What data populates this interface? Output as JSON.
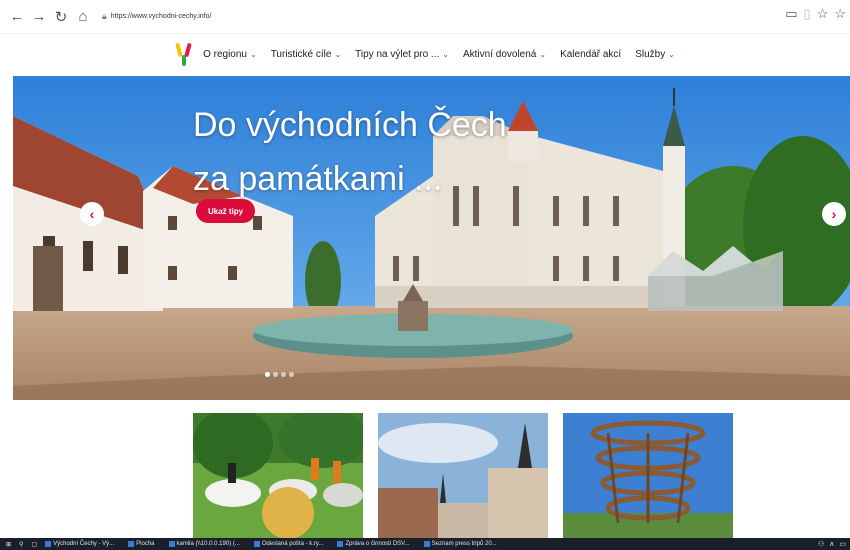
{
  "browser": {
    "url": "https://www.vychodni-cechy.info/"
  },
  "nav": {
    "items": [
      {
        "label": "O regionu",
        "has_dropdown": true
      },
      {
        "label": "Turistické cíle",
        "has_dropdown": true
      },
      {
        "label": "Tipy na výlet pro ...",
        "has_dropdown": true
      },
      {
        "label": "Aktivní dovolená",
        "has_dropdown": true
      },
      {
        "label": "Kalendář akcí",
        "has_dropdown": false
      },
      {
        "label": "Služby",
        "has_dropdown": true
      }
    ]
  },
  "hero": {
    "title_line1": "Do východních Čech",
    "title_line2": "za památkami ...",
    "cta_label": "Ukaž tipy",
    "slides_count": 4,
    "active_slide": 1
  },
  "taskbar": {
    "items": [
      "Východní Čechy - Vý...",
      "Plocha",
      "kamila (\\\\10.0.0.190) (...",
      "Odeslaná pošta - k.ry...",
      "Zpráva o činnosti DSV...",
      "Seznam press tripů 20..."
    ]
  },
  "colors": {
    "accent": "#d90c3b",
    "sky": "#3b8de0"
  },
  "icons": {
    "back": "arrow-left-icon",
    "forward": "arrow-right-icon",
    "refresh": "refresh-icon",
    "home": "home-icon",
    "lock": "lock-icon",
    "reading": "reading-view-icon",
    "favorite": "star-icon"
  }
}
